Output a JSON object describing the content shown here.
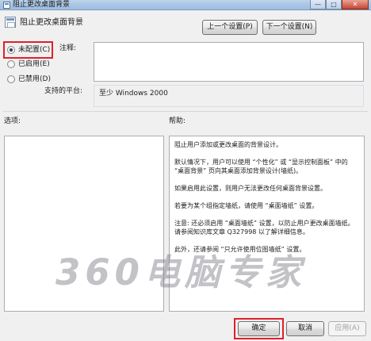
{
  "window": {
    "title": "阻止更改桌面背景",
    "minimize_glyph": "—",
    "maximize_glyph": "□",
    "close_glyph": "✕"
  },
  "header": {
    "policy_title": "阻止更改桌面背景",
    "prev_button": "上一个设置(P)",
    "next_button": "下一个设置(N)"
  },
  "state_options": [
    {
      "label": "未配置(C)",
      "checked": true
    },
    {
      "label": "已启用(E)",
      "checked": false
    },
    {
      "label": "已禁用(D)",
      "checked": false
    }
  ],
  "comment": {
    "label": "注释:",
    "value": ""
  },
  "platform": {
    "label": "支持的平台:",
    "value": "至少 Windows 2000"
  },
  "options_panel": {
    "label": "选项:"
  },
  "help_panel": {
    "label": "帮助:",
    "paragraphs": [
      "阻止用户添加或更改桌面的背景设计。",
      "默认情况下，用户可以使用 “个性化” 或 “显示控制面板” 中的 “桌面背景” 页向其桌面添加背景设计(墙纸)。",
      "如果启用此设置，则用户无法更改任何桌面背景设置。",
      "若要为某个组指定墙纸，请使用 “桌面墙纸” 设置。",
      "注意: 还必须启用 “桌面墙纸” 设置，以防止用户更改桌面墙纸。请参阅知识库文章 Q327998 以了解详细信息。",
      "此外，还请参阅 “只允许使用位图墙纸” 设置。"
    ]
  },
  "footer": {
    "ok_button": "确定",
    "cancel_button": "取消",
    "apply_button": "应用(A)"
  },
  "watermark": "360电脑专家",
  "colors": {
    "highlight_box": "#e0202a",
    "titlebar": "#a9c6e6",
    "dialog_bg": "#f0f0f0"
  }
}
